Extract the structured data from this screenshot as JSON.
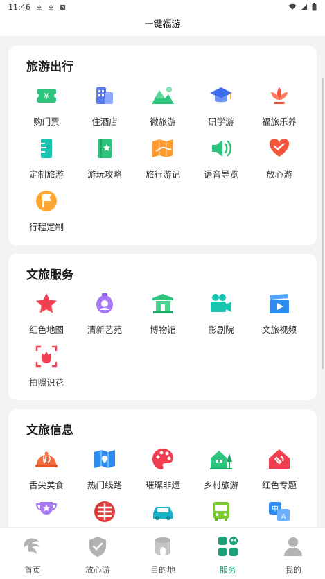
{
  "status": {
    "time": "11:46"
  },
  "header": {
    "title": "一键福游"
  },
  "sections": [
    {
      "title": "旅游出行",
      "items": [
        {
          "label": "购门票",
          "icon": "ticket-icon"
        },
        {
          "label": "住酒店",
          "icon": "hotel-icon"
        },
        {
          "label": "微旅游",
          "icon": "mountain-icon"
        },
        {
          "label": "研学游",
          "icon": "graduation-cap-icon"
        },
        {
          "label": "福旅乐养",
          "icon": "lotus-icon"
        },
        {
          "label": "定制旅游",
          "icon": "ruler-icon"
        },
        {
          "label": "游玩攻略",
          "icon": "guide-book-icon"
        },
        {
          "label": "旅行游记",
          "icon": "map-icon"
        },
        {
          "label": "语音导览",
          "icon": "speaker-icon"
        },
        {
          "label": "放心游",
          "icon": "heart-icon"
        },
        {
          "label": "行程定制",
          "icon": "flag-icon"
        }
      ]
    },
    {
      "title": "文旅服务",
      "items": [
        {
          "label": "红色地图",
          "icon": "red-star-icon"
        },
        {
          "label": "清新艺苑",
          "icon": "lantern-icon"
        },
        {
          "label": "博物馆",
          "icon": "museum-icon"
        },
        {
          "label": "影剧院",
          "icon": "video-camera-icon"
        },
        {
          "label": "文旅视频",
          "icon": "clapperboard-icon"
        },
        {
          "label": "拍照识花",
          "icon": "flower-scan-icon"
        }
      ]
    },
    {
      "title": "文旅信息",
      "items": [
        {
          "label": "舌尖美食",
          "icon": "food-cloche-icon"
        },
        {
          "label": "热门线路",
          "icon": "route-map-icon"
        },
        {
          "label": "璀璨非遗",
          "icon": "palette-icon"
        },
        {
          "label": "乡村旅游",
          "icon": "village-house-icon"
        },
        {
          "label": "红色专题",
          "icon": "red-house-icon"
        },
        {
          "label": "",
          "icon": "trophy-icon"
        },
        {
          "label": "",
          "icon": "heritage-emblem-icon"
        },
        {
          "label": "",
          "icon": "car-icon"
        },
        {
          "label": "",
          "icon": "bus-icon"
        },
        {
          "label": "",
          "icon": "translate-icon"
        }
      ]
    }
  ],
  "tabs": [
    {
      "label": "首页",
      "icon": "home-logo-icon",
      "active": false
    },
    {
      "label": "放心游",
      "icon": "shield-check-icon",
      "active": false
    },
    {
      "label": "目的地",
      "icon": "destination-icon",
      "active": false
    },
    {
      "label": "服务",
      "icon": "services-grid-icon",
      "active": true
    },
    {
      "label": "我的",
      "icon": "user-icon",
      "active": false
    }
  ],
  "colors": {
    "accent": "#1aa37a",
    "background": "#f2f3f5"
  }
}
